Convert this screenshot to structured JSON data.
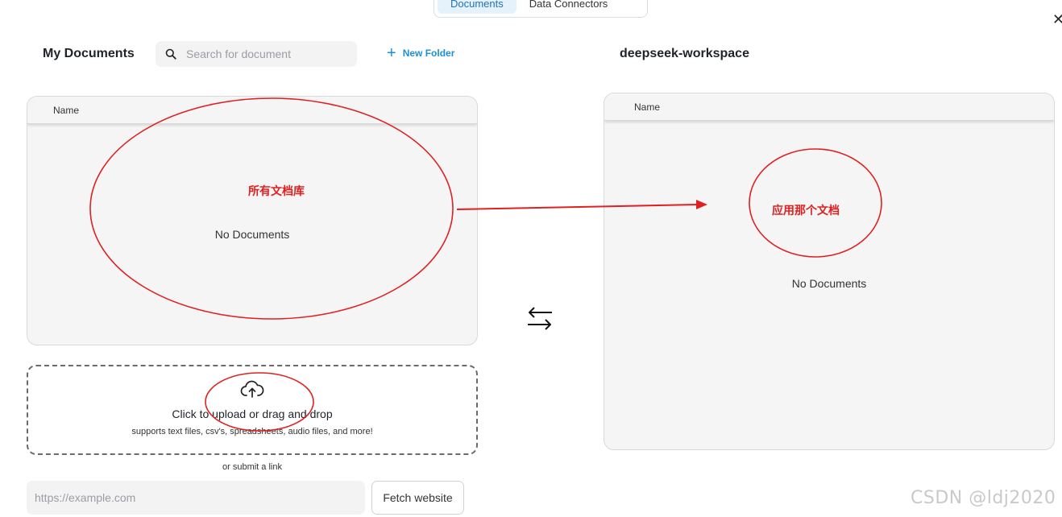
{
  "tabs": [
    {
      "label": "Documents",
      "active": true
    },
    {
      "label": "Data Connectors",
      "active": false
    }
  ],
  "left": {
    "title": "My Documents",
    "search_placeholder": "Search for document",
    "new_folder_label": "New Folder",
    "column_name": "Name",
    "empty_text": "No Documents"
  },
  "upload": {
    "primary": "Click to upload or drag and drop",
    "secondary": "supports text files, csv's, spreadsheets, audio files, and more!"
  },
  "link": {
    "or_text": "or submit a link",
    "url_placeholder": "https://example.com",
    "fetch_label": "Fetch website"
  },
  "right": {
    "title": "deepseek-workspace",
    "column_name": "Name",
    "empty_text": "No Documents"
  },
  "annotations": {
    "left_label": "所有文档库",
    "right_label": "应用那个文档",
    "color": "#e02020"
  },
  "watermark": "CSDN @ldj2020",
  "colors": {
    "accent": "#1e8fd6",
    "active_tab_bg": "#e5f2fb",
    "panel_bg": "#f5f5f5"
  },
  "icons": {
    "search": "search-icon",
    "plus": "plus-icon",
    "upload": "cloud-upload-icon",
    "swap": "swap-arrows-icon",
    "close": "close-icon"
  }
}
